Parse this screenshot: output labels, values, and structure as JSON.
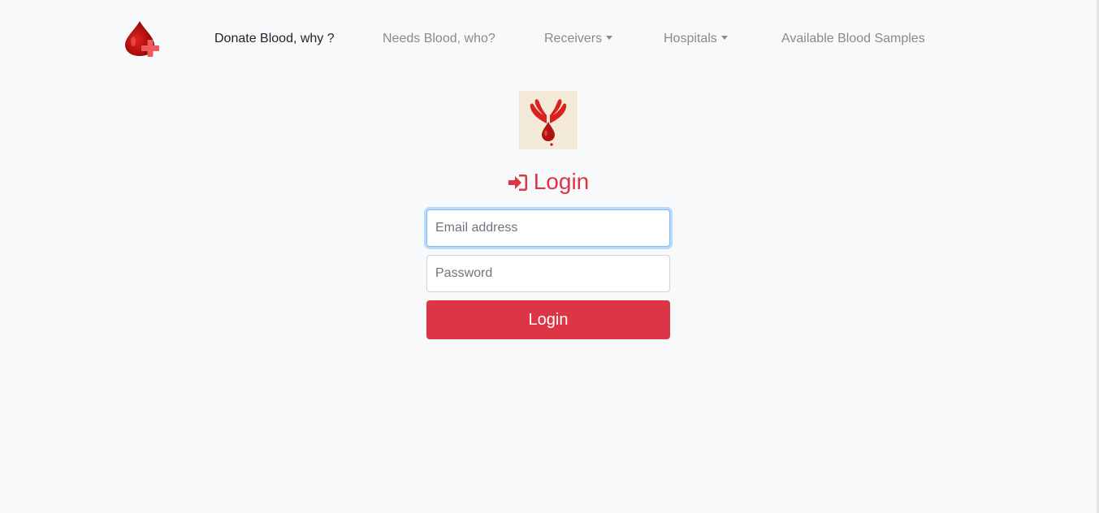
{
  "nav": {
    "brand_icon": "blood-drop-plus-icon",
    "items": [
      {
        "label": "Donate Blood, why ?",
        "active": true,
        "dropdown": false
      },
      {
        "label": "Needs Blood, who?",
        "active": false,
        "dropdown": false
      },
      {
        "label": "Receivers",
        "active": false,
        "dropdown": true
      },
      {
        "label": "Hospitals",
        "active": false,
        "dropdown": true
      },
      {
        "label": "Available Blood Samples",
        "active": false,
        "dropdown": false
      }
    ]
  },
  "login": {
    "image_icon": "hands-blood-drop-icon",
    "title": "Login",
    "title_icon": "sign-in-icon",
    "email_placeholder": "Email address",
    "email_value": "",
    "password_placeholder": "Password",
    "password_value": "",
    "submit_label": "Login"
  },
  "colors": {
    "accent": "#dc3545",
    "background": "#f8f9fa",
    "focus_border": "#80bdff"
  }
}
